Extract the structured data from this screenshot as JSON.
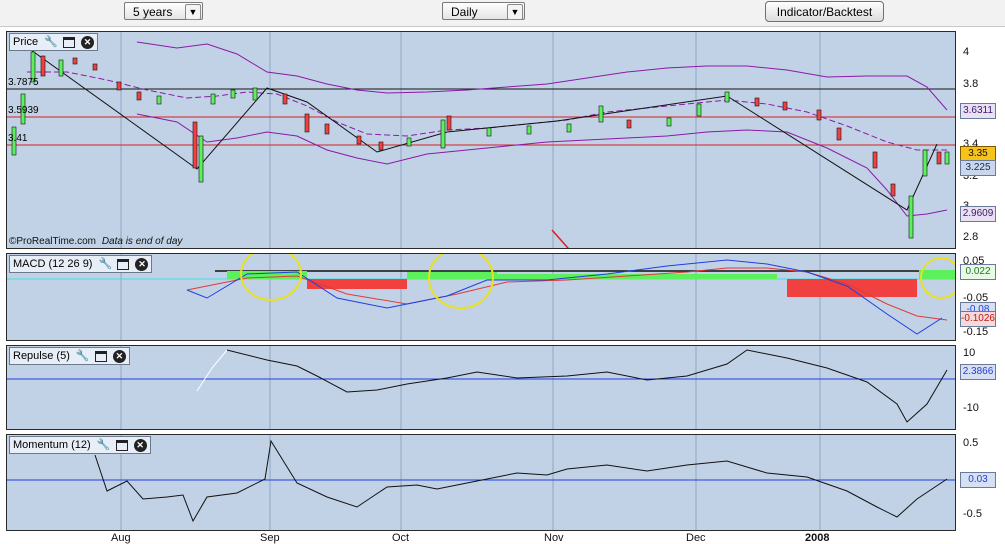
{
  "toolbar": {
    "period_select": "5 years",
    "interval_select": "Daily",
    "indicator_button": "Indicator/Backtest"
  },
  "price_panel": {
    "title": "Price",
    "watermark_source": "©ProRealTime.com",
    "watermark_note": "Data is end of day",
    "left_labels": [
      "3.7875",
      "3.5939",
      "3.41"
    ],
    "axis_ticks": [
      "4",
      "3.8",
      "3.6",
      "3.4",
      "3.2",
      "3",
      "2.8"
    ],
    "value_badges": {
      "upper": "3.6311",
      "price": "3.35",
      "lower_band": "3.225",
      "bottom": "2.9609"
    }
  },
  "macd_panel": {
    "title": "MACD (12 26 9)",
    "axis_ticks": [
      "0.05",
      "-0.05",
      "-0.15"
    ],
    "value_badges": {
      "hist": "0.022",
      "signal": "-0.08",
      "macd": "-0.1026"
    }
  },
  "repulse_panel": {
    "title": "Repulse (5)",
    "axis_ticks": [
      "10",
      "-10"
    ],
    "value_badge": "2.3866"
  },
  "momentum_panel": {
    "title": "Momentum (12)",
    "axis_ticks": [
      "0.5",
      "-0.5"
    ],
    "value_badge": "0.03"
  },
  "x_axis": {
    "labels": [
      "Aug",
      "Sep",
      "Oct",
      "Nov",
      "Dec",
      "2008"
    ]
  },
  "colors": {
    "pane_bg": "#c2d2e6",
    "bollinger": "#8a1aa8",
    "macd_line": "#1f3fe0",
    "signal_line": "#e03a3a",
    "hist_pos": "#5cf15c",
    "hist_neg": "#f04040",
    "resistance": "#d82020",
    "annotation": "#e8e020"
  },
  "icons": {
    "settings": "wrench-icon",
    "window": "window-icon",
    "close": "close-icon",
    "arrow": "down-arrow-annotation"
  }
}
